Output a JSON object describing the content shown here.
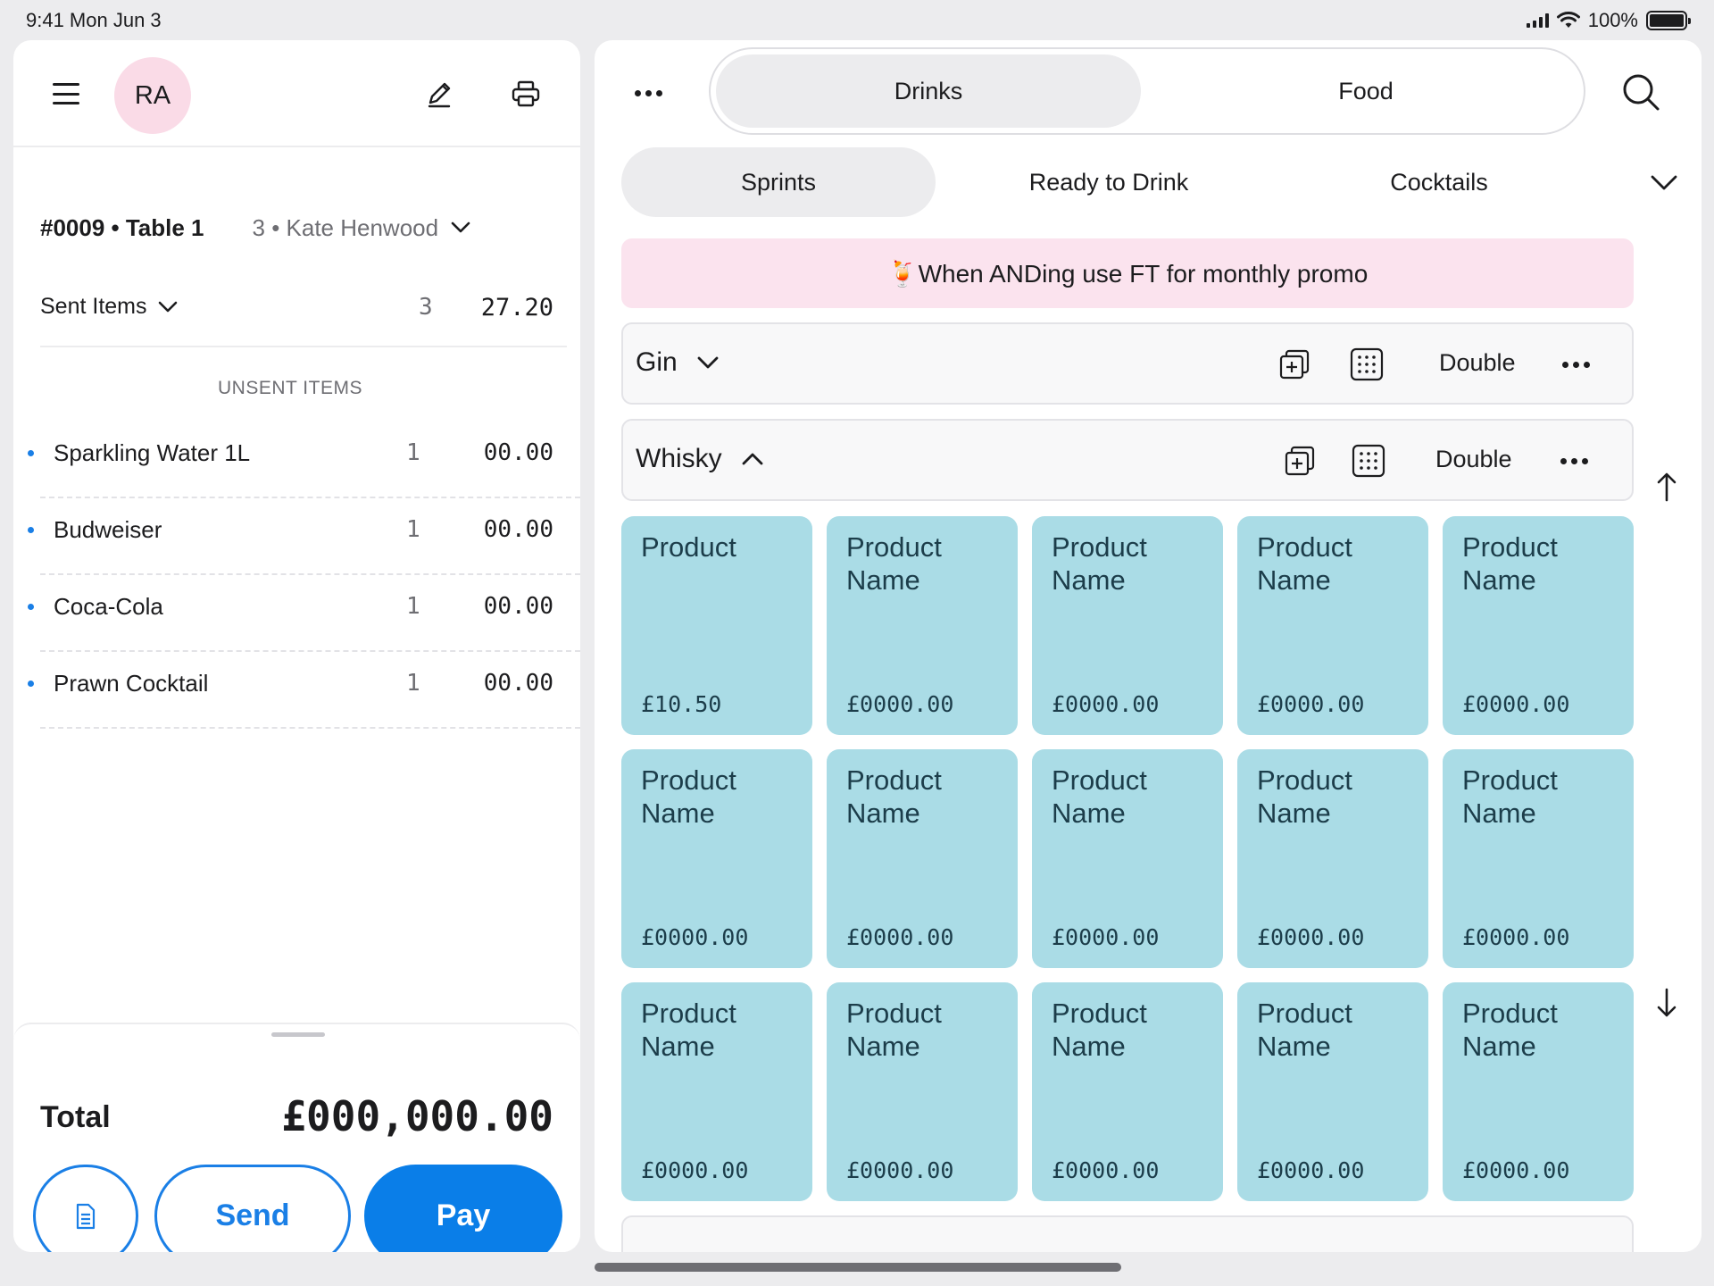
{
  "status_bar": {
    "time_date": "9:41  Mon Jun 3",
    "battery": "100%"
  },
  "order_panel": {
    "avatar_initials": "RA",
    "order_id": "#0009 • Table 1",
    "guest": "3 • Kate Henwood",
    "sent": {
      "label": "Sent Items",
      "count": "3",
      "total": "27.20"
    },
    "unsent_heading": "UNSENT ITEMS",
    "items": [
      {
        "name": "Sparkling Water 1L",
        "qty": "1",
        "price": "00.00"
      },
      {
        "name": "Budweiser",
        "qty": "1",
        "price": "00.00"
      },
      {
        "name": "Coca-Cola",
        "qty": "1",
        "price": "00.00"
      },
      {
        "name": "Prawn Cocktail",
        "qty": "1",
        "price": "00.00"
      }
    ],
    "total_label": "Total",
    "total_value": "£000,000.00",
    "send_label": "Send",
    "pay_label": "Pay"
  },
  "menu_panel": {
    "tabs": [
      {
        "label": "Drinks",
        "active": true
      },
      {
        "label": "Food",
        "active": false
      }
    ],
    "subtabs": [
      {
        "label": "Sprints",
        "active": true
      },
      {
        "label": "Ready to Drink",
        "active": false
      },
      {
        "label": "Cocktails",
        "active": false
      }
    ],
    "promo": "🍹When ANDing use FT for monthly promo",
    "groups": [
      {
        "name": "Gin",
        "expanded": false,
        "portion": "Double"
      },
      {
        "name": "Whisky",
        "expanded": true,
        "portion": "Double"
      }
    ],
    "products": [
      {
        "name": "Product",
        "price": "£10.50"
      },
      {
        "name": "Product Name",
        "price": "£0000.00"
      },
      {
        "name": "Product Name",
        "price": "£0000.00"
      },
      {
        "name": "Product Name",
        "price": "£0000.00"
      },
      {
        "name": "Product Name",
        "price": "£0000.00"
      },
      {
        "name": "Product Name",
        "price": "£0000.00"
      },
      {
        "name": "Product Name",
        "price": "£0000.00"
      },
      {
        "name": "Product Name",
        "price": "£0000.00"
      },
      {
        "name": "Product Name",
        "price": "£0000.00"
      },
      {
        "name": "Product Name",
        "price": "£0000.00"
      },
      {
        "name": "Product Name",
        "price": "£0000.00"
      },
      {
        "name": "Product Name",
        "price": "£0000.00"
      },
      {
        "name": "Product Name",
        "price": "£0000.00"
      },
      {
        "name": "Product Name",
        "price": "£0000.00"
      },
      {
        "name": "Product Name",
        "price": "£0000.00"
      }
    ]
  },
  "colors": {
    "accent": "#0a7ee8",
    "tile": "#aadce6",
    "promo_bg": "#fbe3ee",
    "avatar_bg": "#fadbe7"
  }
}
